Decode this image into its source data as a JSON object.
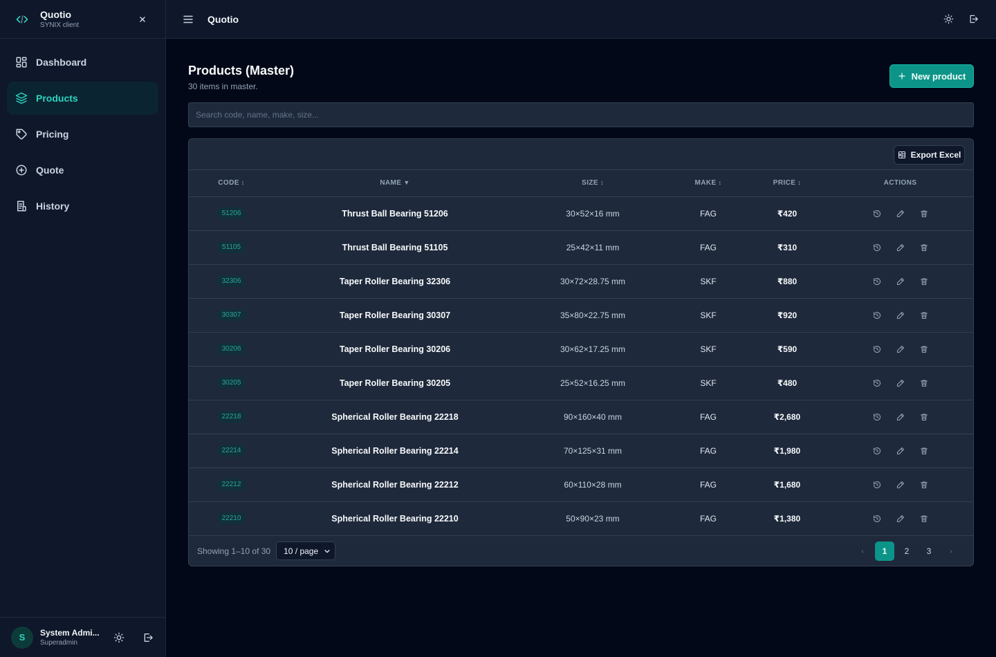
{
  "brand": {
    "title": "Quotio",
    "subtitle": "SYNIX client"
  },
  "nav": [
    {
      "label": "Dashboard",
      "icon": "dashboard-icon",
      "active": false
    },
    {
      "label": "Products",
      "icon": "layers-icon",
      "active": true
    },
    {
      "label": "Pricing",
      "icon": "tag-icon",
      "active": false
    },
    {
      "label": "Quote",
      "icon": "plus-circle-icon",
      "active": false
    },
    {
      "label": "History",
      "icon": "receipt-icon",
      "active": false
    }
  ],
  "user": {
    "initial": "S",
    "name": "System Admi...",
    "role": "Superadmin"
  },
  "topbar": {
    "title": "Quotio"
  },
  "page": {
    "title": "Products (Master)",
    "subtitle": "30 items in master.",
    "new_button": "New product",
    "search_placeholder": "Search code, name, make, size..."
  },
  "table": {
    "export_label": "Export Excel",
    "headers": {
      "code": "CODE",
      "name": "NAME",
      "size": "SIZE",
      "make": "MAKE",
      "price": "PRICE",
      "actions": "ACTIONS"
    },
    "rows": [
      {
        "code": "51206",
        "name": "Thrust Ball Bearing 51206",
        "size": "30×52×16 mm",
        "make": "FAG",
        "price": "₹420"
      },
      {
        "code": "51105",
        "name": "Thrust Ball Bearing 51105",
        "size": "25×42×11 mm",
        "make": "FAG",
        "price": "₹310"
      },
      {
        "code": "32306",
        "name": "Taper Roller Bearing 32306",
        "size": "30×72×28.75 mm",
        "make": "SKF",
        "price": "₹880"
      },
      {
        "code": "30307",
        "name": "Taper Roller Bearing 30307",
        "size": "35×80×22.75 mm",
        "make": "SKF",
        "price": "₹920"
      },
      {
        "code": "30206",
        "name": "Taper Roller Bearing 30206",
        "size": "30×62×17.25 mm",
        "make": "SKF",
        "price": "₹590"
      },
      {
        "code": "30205",
        "name": "Taper Roller Bearing 30205",
        "size": "25×52×16.25 mm",
        "make": "SKF",
        "price": "₹480"
      },
      {
        "code": "22218",
        "name": "Spherical Roller Bearing 22218",
        "size": "90×160×40 mm",
        "make": "FAG",
        "price": "₹2,680"
      },
      {
        "code": "22214",
        "name": "Spherical Roller Bearing 22214",
        "size": "70×125×31 mm",
        "make": "FAG",
        "price": "₹1,980"
      },
      {
        "code": "22212",
        "name": "Spherical Roller Bearing 22212",
        "size": "60×110×28 mm",
        "make": "FAG",
        "price": "₹1,680"
      },
      {
        "code": "22210",
        "name": "Spherical Roller Bearing 22210",
        "size": "50×90×23 mm",
        "make": "FAG",
        "price": "₹1,380"
      }
    ],
    "showing": "Showing 1–10 of 30",
    "per_page": "10 / page",
    "pages": [
      "1",
      "2",
      "3"
    ],
    "current_page": "1",
    "prev": "‹",
    "next": "›"
  },
  "colors": {
    "accent": "#0d9488",
    "accent_text": "#2dd4bf",
    "background": "#020817",
    "panel": "#0f172a",
    "card": "#1e293b"
  }
}
